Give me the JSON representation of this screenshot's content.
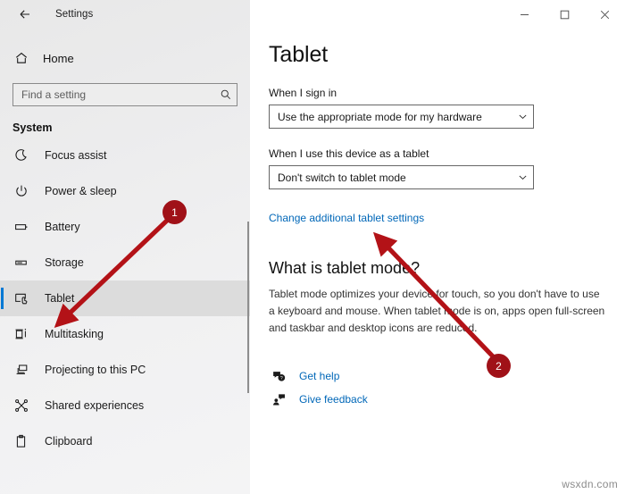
{
  "window": {
    "app_title": "Settings",
    "back_icon": "back-arrow-icon",
    "controls": {
      "minimize": "minimize-icon",
      "maximize": "maximize-icon",
      "close": "close-icon"
    }
  },
  "sidebar": {
    "home_label": "Home",
    "home_icon": "home-icon",
    "search": {
      "placeholder": "Find a setting",
      "value": "",
      "icon": "search-icon"
    },
    "section_title": "System",
    "items": [
      {
        "label": "Focus assist",
        "icon": "moon-icon",
        "selected": false
      },
      {
        "label": "Power & sleep",
        "icon": "power-icon",
        "selected": false
      },
      {
        "label": "Battery",
        "icon": "battery-icon",
        "selected": false
      },
      {
        "label": "Storage",
        "icon": "storage-icon",
        "selected": false
      },
      {
        "label": "Tablet",
        "icon": "tablet-icon",
        "selected": true
      },
      {
        "label": "Multitasking",
        "icon": "multitasking-icon",
        "selected": false
      },
      {
        "label": "Projecting to this PC",
        "icon": "projecting-icon",
        "selected": false
      },
      {
        "label": "Shared experiences",
        "icon": "share-nodes-icon",
        "selected": false
      },
      {
        "label": "Clipboard",
        "icon": "clipboard-icon",
        "selected": false
      }
    ],
    "scrollbar": "vertical-scrollbar"
  },
  "main": {
    "page_title": "Tablet",
    "sign_in": {
      "label": "When I sign in",
      "value": "Use the appropriate mode for my hardware",
      "chevron": "chevron-down-icon"
    },
    "device_as_tablet": {
      "label": "When I use this device as a tablet",
      "value": "Don't switch to tablet mode",
      "chevron": "chevron-down-icon"
    },
    "additional_settings_link": "Change additional tablet settings",
    "info": {
      "heading": "What is tablet mode?",
      "body": "Tablet mode optimizes your device for touch, so you don't have to use a keyboard and mouse. When tablet mode is on, apps open full-screen and taskbar and desktop icons are reduced."
    },
    "help_links": [
      {
        "label": "Get help",
        "icon": "help-bubble-icon"
      },
      {
        "label": "Give feedback",
        "icon": "feedback-person-icon"
      }
    ]
  },
  "annotations": {
    "markers": [
      {
        "number": "1",
        "points_to": "sidebar-item-tablet"
      },
      {
        "number": "2",
        "points_to": "additional-tablet-settings-link"
      }
    ],
    "arrow_color": "#b31217"
  },
  "watermark": "wsxdn.com"
}
